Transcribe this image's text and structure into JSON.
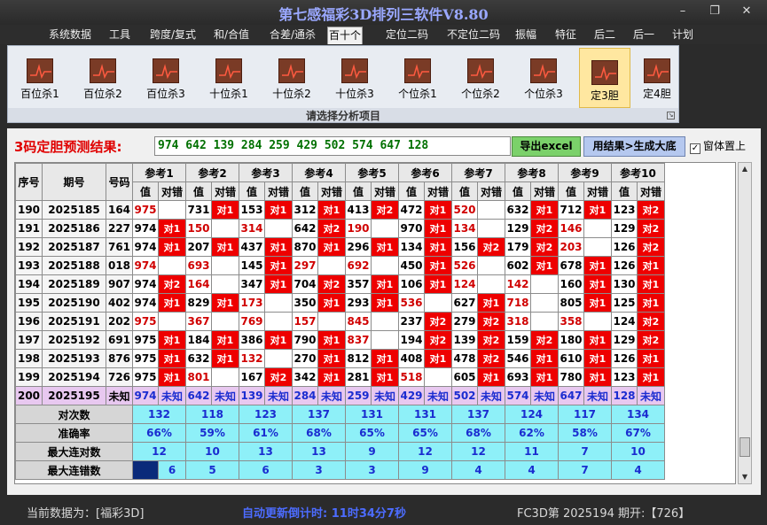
{
  "app": {
    "title": "第七感福彩3D排列三软件V8.80"
  },
  "menu": [
    "系统数据",
    "工具",
    "跨度/复式",
    "和/合值",
    "合差/通杀",
    "百十个",
    "定位二码",
    "不定位二码",
    "振幅",
    "特征",
    "后二",
    "后一",
    "计划"
  ],
  "menu_active": "百十个",
  "ribbon": {
    "items": [
      "百位杀1",
      "百位杀2",
      "百位杀3",
      "十位杀1",
      "十位杀2",
      "十位杀3",
      "个位杀1",
      "个位杀2",
      "个位杀3",
      "定3胆",
      "定4胆"
    ],
    "selected": "定3胆",
    "caption": "请选择分析项目"
  },
  "result": {
    "label": "3码定胆预测结果:",
    "value": "974 642 139 284 259 429 502 574 647 128",
    "export_label": "导出excel",
    "generate_label": "用结果>生成大底",
    "ontop_label": "窗体置上",
    "ontop_checked": "✓"
  },
  "grid": {
    "headers": {
      "seq": "序号",
      "period": "期号",
      "number": "号码",
      "value": "值",
      "check": "对错"
    },
    "refs": [
      "参考1",
      "参考2",
      "参考3",
      "参考4",
      "参考5",
      "参考6",
      "参考7",
      "参考8",
      "参考9",
      "参考10"
    ],
    "rows": [
      {
        "seq": "190",
        "period": "2025185",
        "num": "164",
        "cells": [
          [
            "975",
            "r",
            ""
          ],
          [
            "731",
            "b",
            "对1"
          ],
          [
            "153",
            "b",
            "对1"
          ],
          [
            "312",
            "b",
            "对1"
          ],
          [
            "413",
            "b",
            "对2"
          ],
          [
            "472",
            "b",
            "对1"
          ],
          [
            "520",
            "r",
            ""
          ],
          [
            "632",
            "b",
            "对1"
          ],
          [
            "712",
            "b",
            "对1"
          ],
          [
            "123",
            "b",
            "对2"
          ]
        ]
      },
      {
        "seq": "191",
        "period": "2025186",
        "num": "227",
        "cells": [
          [
            "974",
            "b",
            "对1"
          ],
          [
            "150",
            "r",
            ""
          ],
          [
            "314",
            "r",
            ""
          ],
          [
            "642",
            "b",
            "对2"
          ],
          [
            "190",
            "r",
            ""
          ],
          [
            "970",
            "b",
            "对1"
          ],
          [
            "134",
            "r",
            ""
          ],
          [
            "129",
            "b",
            "对2"
          ],
          [
            "146",
            "r",
            ""
          ],
          [
            "129",
            "b",
            "对2"
          ]
        ]
      },
      {
        "seq": "192",
        "period": "2025187",
        "num": "761",
        "cells": [
          [
            "974",
            "b",
            "对1"
          ],
          [
            "207",
            "b",
            "对1"
          ],
          [
            "437",
            "b",
            "对1"
          ],
          [
            "870",
            "b",
            "对1"
          ],
          [
            "296",
            "b",
            "对1"
          ],
          [
            "134",
            "b",
            "对1"
          ],
          [
            "156",
            "b",
            "对2"
          ],
          [
            "179",
            "b",
            "对2"
          ],
          [
            "203",
            "r",
            ""
          ],
          [
            "126",
            "b",
            "对2"
          ]
        ]
      },
      {
        "seq": "193",
        "period": "2025188",
        "num": "018",
        "cells": [
          [
            "974",
            "r",
            ""
          ],
          [
            "693",
            "r",
            ""
          ],
          [
            "145",
            "b",
            "对1"
          ],
          [
            "297",
            "r",
            ""
          ],
          [
            "692",
            "r",
            ""
          ],
          [
            "450",
            "b",
            "对1"
          ],
          [
            "526",
            "r",
            ""
          ],
          [
            "602",
            "b",
            "对1"
          ],
          [
            "678",
            "b",
            "对1"
          ],
          [
            "126",
            "b",
            "对1"
          ]
        ]
      },
      {
        "seq": "194",
        "period": "2025189",
        "num": "907",
        "cells": [
          [
            "974",
            "b",
            "对2"
          ],
          [
            "164",
            "r",
            ""
          ],
          [
            "347",
            "b",
            "对1"
          ],
          [
            "704",
            "b",
            "对2"
          ],
          [
            "357",
            "b",
            "对1"
          ],
          [
            "106",
            "b",
            "对1"
          ],
          [
            "124",
            "r",
            ""
          ],
          [
            "142",
            "r",
            ""
          ],
          [
            "160",
            "b",
            "对1"
          ],
          [
            "130",
            "b",
            "对1"
          ]
        ]
      },
      {
        "seq": "195",
        "period": "2025190",
        "num": "402",
        "cells": [
          [
            "974",
            "b",
            "对1"
          ],
          [
            "829",
            "b",
            "对1"
          ],
          [
            "173",
            "r",
            ""
          ],
          [
            "350",
            "b",
            "对1"
          ],
          [
            "293",
            "b",
            "对1"
          ],
          [
            "536",
            "r",
            ""
          ],
          [
            "627",
            "b",
            "对1"
          ],
          [
            "718",
            "r",
            ""
          ],
          [
            "805",
            "b",
            "对1"
          ],
          [
            "125",
            "b",
            "对1"
          ]
        ]
      },
      {
        "seq": "196",
        "period": "2025191",
        "num": "202",
        "cells": [
          [
            "975",
            "r",
            ""
          ],
          [
            "367",
            "r",
            ""
          ],
          [
            "769",
            "r",
            ""
          ],
          [
            "157",
            "r",
            ""
          ],
          [
            "845",
            "r",
            ""
          ],
          [
            "237",
            "b",
            "对2"
          ],
          [
            "279",
            "b",
            "对2"
          ],
          [
            "318",
            "r",
            ""
          ],
          [
            "358",
            "r",
            ""
          ],
          [
            "124",
            "b",
            "对2"
          ]
        ]
      },
      {
        "seq": "197",
        "period": "2025192",
        "num": "691",
        "cells": [
          [
            "975",
            "b",
            "对1"
          ],
          [
            "184",
            "b",
            "对1"
          ],
          [
            "386",
            "b",
            "对1"
          ],
          [
            "790",
            "b",
            "对1"
          ],
          [
            "837",
            "r",
            ""
          ],
          [
            "194",
            "b",
            "对2"
          ],
          [
            "139",
            "b",
            "对2"
          ],
          [
            "159",
            "b",
            "对2"
          ],
          [
            "180",
            "b",
            "对1"
          ],
          [
            "129",
            "b",
            "对2"
          ]
        ]
      },
      {
        "seq": "198",
        "period": "2025193",
        "num": "876",
        "cells": [
          [
            "975",
            "b",
            "对1"
          ],
          [
            "632",
            "b",
            "对1"
          ],
          [
            "132",
            "r",
            ""
          ],
          [
            "270",
            "b",
            "对1"
          ],
          [
            "812",
            "b",
            "对1"
          ],
          [
            "408",
            "b",
            "对1"
          ],
          [
            "478",
            "b",
            "对2"
          ],
          [
            "546",
            "b",
            "对1"
          ],
          [
            "610",
            "b",
            "对1"
          ],
          [
            "126",
            "b",
            "对1"
          ]
        ]
      },
      {
        "seq": "199",
        "period": "2025194",
        "num": "726",
        "cells": [
          [
            "975",
            "b",
            "对1"
          ],
          [
            "801",
            "r",
            ""
          ],
          [
            "167",
            "b",
            "对2"
          ],
          [
            "342",
            "b",
            "对1"
          ],
          [
            "281",
            "b",
            "对1"
          ],
          [
            "518",
            "r",
            ""
          ],
          [
            "605",
            "b",
            "对1"
          ],
          [
            "693",
            "b",
            "对1"
          ],
          [
            "780",
            "b",
            "对1"
          ],
          [
            "123",
            "b",
            "对1"
          ]
        ]
      }
    ],
    "pred_row": {
      "seq": "200",
      "period": "2025195",
      "num": "未知",
      "values": [
        "974",
        "642",
        "139",
        "284",
        "259",
        "429",
        "502",
        "574",
        "647",
        "128"
      ],
      "unknown": "未知"
    },
    "stats": [
      {
        "label": "对次数",
        "values": [
          "132",
          "118",
          "123",
          "137",
          "131",
          "131",
          "137",
          "124",
          "117",
          "134"
        ]
      },
      {
        "label": "准确率",
        "values": [
          "66%",
          "59%",
          "61%",
          "68%",
          "65%",
          "65%",
          "68%",
          "62%",
          "58%",
          "67%"
        ]
      },
      {
        "label": "最大连对数",
        "values": [
          "12",
          "10",
          "13",
          "13",
          "9",
          "12",
          "12",
          "11",
          "7",
          "10"
        ]
      },
      {
        "label": "最大连错数",
        "values": [
          "6",
          "5",
          "6",
          "3",
          "3",
          "9",
          "4",
          "4",
          "7",
          "4"
        ]
      }
    ]
  },
  "status": {
    "current_data": "当前数据为：[福彩3D]",
    "timer": "自动更新倒计时:  11时34分7秒",
    "issue": "FC3D第 2025194 期开:【726】"
  }
}
